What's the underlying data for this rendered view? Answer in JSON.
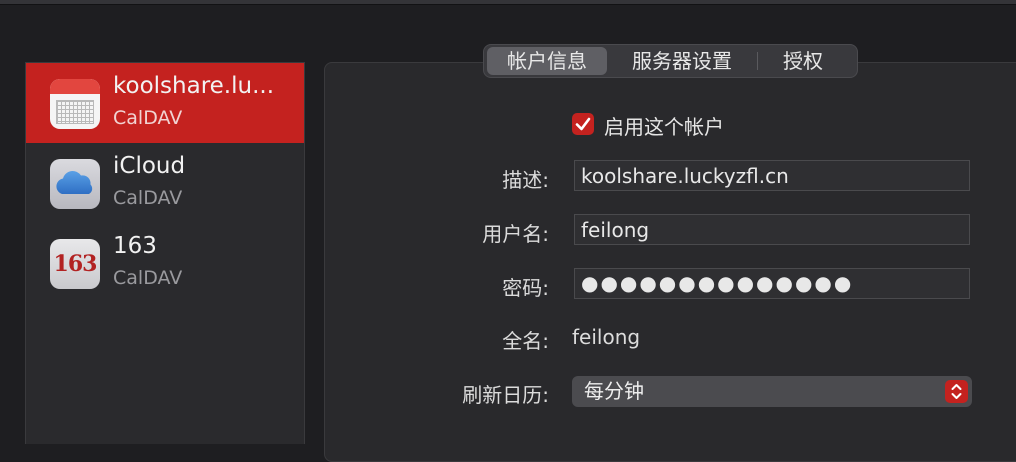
{
  "sidebar": {
    "accounts": [
      {
        "name": "koolshare.lu...",
        "type": "CalDAV",
        "icon": "calendar-icon"
      },
      {
        "name": "iCloud",
        "type": "CalDAV",
        "icon": "icloud-icon"
      },
      {
        "name": "163",
        "type": "CalDAV",
        "icon": "163-icon",
        "icon_text": "163"
      }
    ]
  },
  "tabs": [
    "帐户信息",
    "服务器设置",
    "授权"
  ],
  "form": {
    "enable_label": "启用这个帐户",
    "enable_checked": true,
    "description_label": "描述:",
    "description_value": "koolshare.luckyzfl.cn",
    "username_label": "用户名:",
    "username_value": "feilong",
    "password_label": "密码:",
    "password_value": "●●●●●●●●●●●●●●",
    "fullname_label": "全名:",
    "fullname_value": "feilong",
    "refresh_label": "刷新日历:",
    "refresh_value": "每分钟"
  },
  "colors": {
    "accent": "#c4221f",
    "background": "#1e1e21",
    "panel": "#29292c"
  }
}
